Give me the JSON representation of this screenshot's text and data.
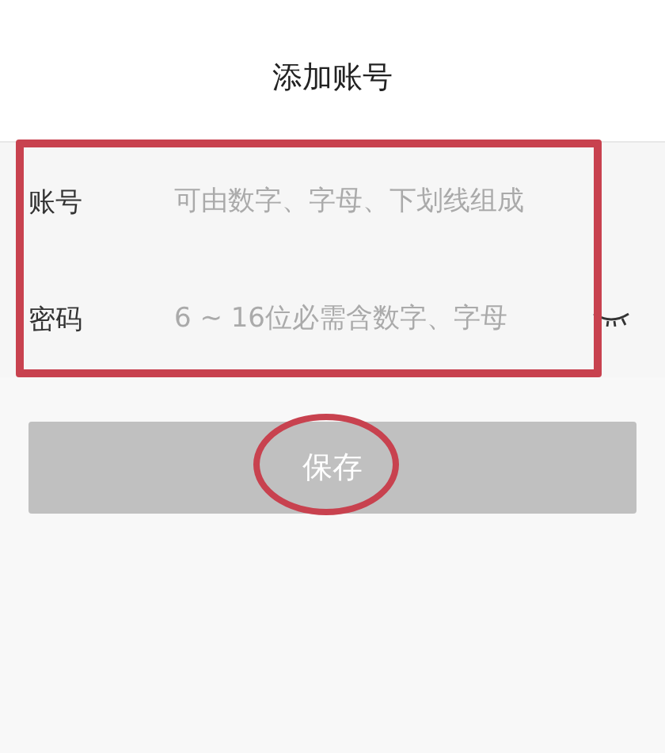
{
  "header": {
    "title": "添加账号"
  },
  "form": {
    "fields": [
      {
        "kind": "text",
        "label": "账号",
        "placeholder": "可由数字、字母、下划线组成"
      },
      {
        "kind": "password",
        "label": "密码",
        "placeholder": "6 ~ 16位必需含数字、字母",
        "visible": false
      }
    ]
  },
  "save_button": {
    "label": "保存",
    "disabled": true
  },
  "highlight_frame": {
    "color": "#c8424f"
  },
  "highlight_ellipse": {
    "color": "#c8424f"
  }
}
